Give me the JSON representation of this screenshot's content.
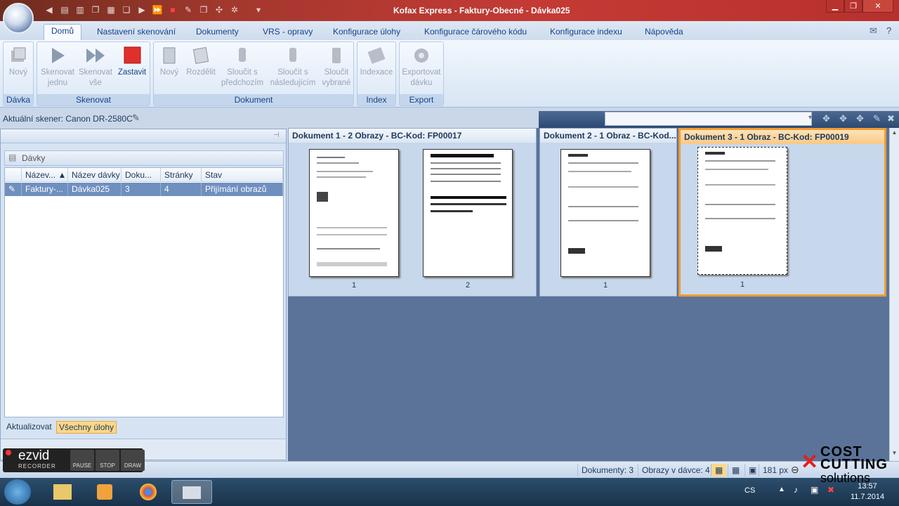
{
  "window": {
    "title": "Kofax Express - Faktury-Obecné - Dávka025"
  },
  "menu": {
    "tabs": [
      "Domů",
      "Nastavení skenování",
      "Dokumenty",
      "VRS - opravy",
      "Konfigurace úlohy",
      "Konfigurace čárového kódu",
      "Konfigurace indexu",
      "Nápověda"
    ]
  },
  "ribbon": {
    "groups": {
      "davka": "Dávka",
      "skenovat": "Skenovat",
      "dokument": "Dokument",
      "index": "Index",
      "export": "Export"
    },
    "buttons": {
      "novy": "Nový",
      "skenovat_jednu_1": "Skenovat",
      "skenovat_jednu_2": "jednu",
      "skenovat_vse_1": "Skenovat",
      "skenovat_vse_2": "vše",
      "zastavit": "Zastavit",
      "novy_doc": "Nový",
      "rozdelit": "Rozdělit",
      "sloucit_pred_1": "Sloučit s",
      "sloucit_pred_2": "předchozím",
      "sloucit_nasl_1": "Sloučit s",
      "sloucit_nasl_2": "následujícím",
      "sloucit_vyb_1": "Sloučit",
      "sloucit_vyb_2": "vybrané",
      "indexace": "Indexace",
      "exportovat_1": "Exportovat",
      "exportovat_2": "dávku"
    }
  },
  "scanner": {
    "label": "Aktuální skener: Canon DR-2580C"
  },
  "batches": {
    "header": "Dávky",
    "columns": [
      "Název... ▲",
      "Název dávky",
      "Doku...",
      "Stránky",
      "Stav"
    ],
    "row": [
      "Faktury-...",
      "Dávka025",
      "3",
      "4",
      "Přijímání obrazů"
    ],
    "footer": {
      "refresh": "Aktualizovat",
      "all_jobs": "Všechny úlohy"
    }
  },
  "documents": [
    {
      "title": "Dokument 1 - 2 Obrazy - BC-Kod: FP00017",
      "pages": [
        "1",
        "2"
      ]
    },
    {
      "title": "Dokument 2 - 1 Obraz - BC-Kod...",
      "pages": [
        "1"
      ]
    },
    {
      "title": "Dokument 3 - 1 Obraz - BC-Kod: FP00019",
      "pages": [
        "1"
      ]
    }
  ],
  "status": {
    "documents": "Dokumenty: 3",
    "images": "Obrazy v dávce: 4",
    "zoom": "181 px"
  },
  "taskbar": {
    "lang": "CS",
    "time": "13:57",
    "date": "11.7.2014"
  },
  "overlays": {
    "ezvid": "ezvid",
    "ezvid_sub": "RECORDER",
    "pause": "PAUSE",
    "stop": "STOP",
    "draw": "DRAW",
    "cost_1": "COST",
    "cost_2": "CUTTING",
    "cost_3": "solutions"
  }
}
